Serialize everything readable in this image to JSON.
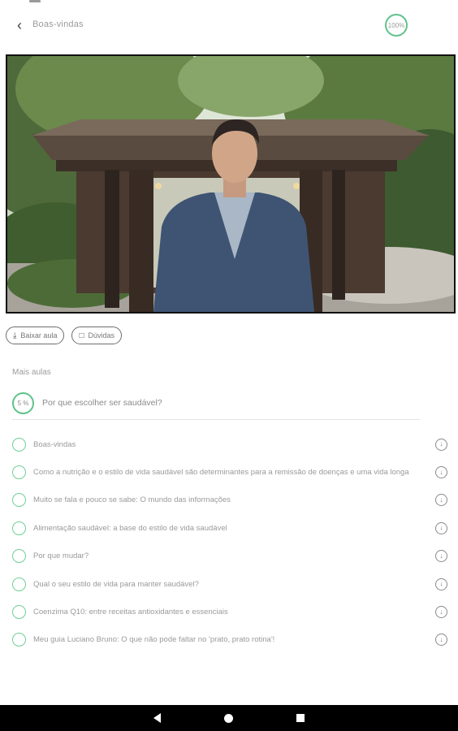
{
  "header": {
    "back_icon": "chevron-left-icon",
    "title": "Boas-vindas",
    "progress": "100%"
  },
  "actions": {
    "download_label": "Baixar aula",
    "download_icon": "download-icon",
    "questions_label": "Dúvidas",
    "questions_icon": "chat-icon"
  },
  "course": {
    "section_label": "Mais aulas",
    "module_progress": "5 %",
    "module_title": "Por que escolher ser saudável?"
  },
  "lessons": [
    {
      "title": "Boas-vindas"
    },
    {
      "title": "Como a nutrição e o estilo de vida saudável são determinantes para a remissão de doenças e uma vida longa"
    },
    {
      "title": "Muito se fala e pouco se sabe: O mundo das informações"
    },
    {
      "title": "Alimentação saudável: a base do estilo de vida saudável"
    },
    {
      "title": "Por que mudar?"
    },
    {
      "title": "Qual o seu estilo de vida para manter saudável?"
    },
    {
      "title": "Coenzima Q10: entre receitas antioxidantes e essenciais"
    },
    {
      "title": "Meu guia Luciano Bruno: O que não pode faltar no 'prato, prato rotina'!"
    }
  ],
  "icons": {
    "lesson_status": "circle-check-icon",
    "lesson_download": "download-circle-icon"
  },
  "colors": {
    "accent": "#5ec28a",
    "nav_bar": "#000000"
  }
}
